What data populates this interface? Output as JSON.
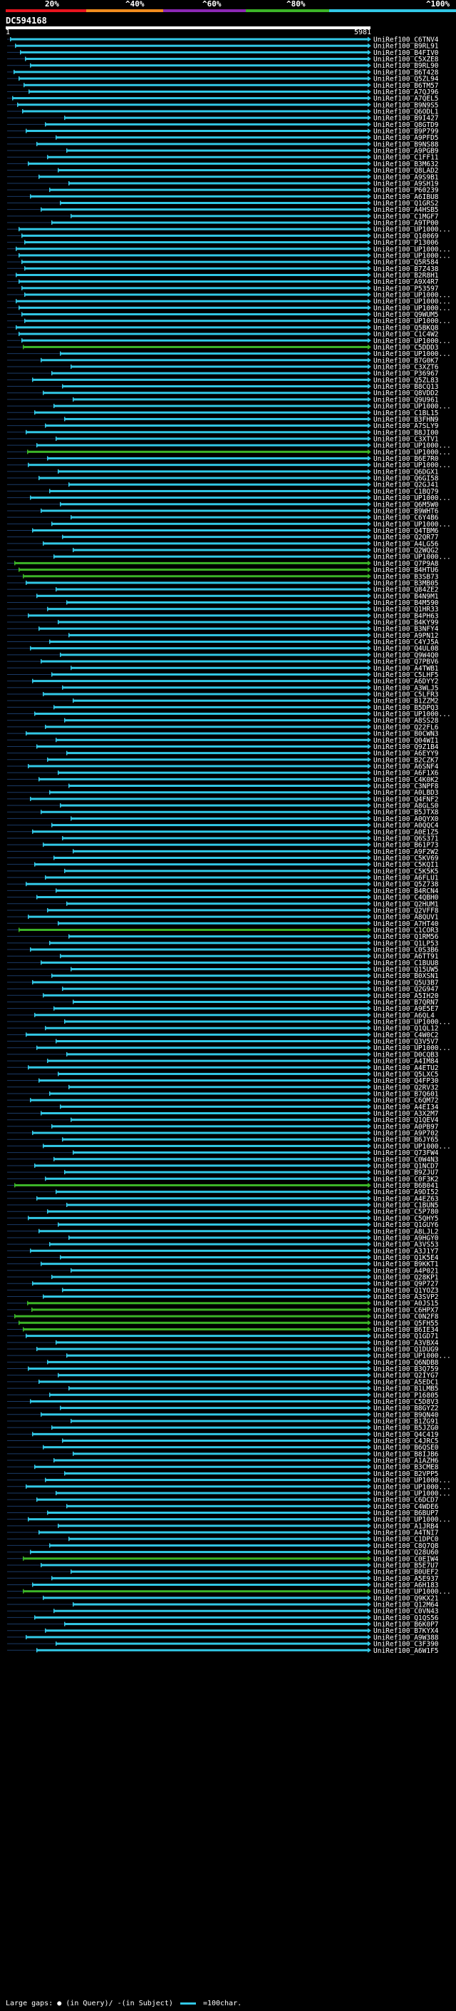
{
  "legend": {
    "labels": [
      "20%",
      "^40%",
      "^60%",
      "^80%",
      "^100%"
    ],
    "colors": [
      "#e8141e",
      "#f08c1e",
      "#8c28b4",
      "#3cb428",
      "#32c8e6"
    ]
  },
  "query": {
    "name": "DC594168",
    "start": "1",
    "end": "5981"
  },
  "footer": {
    "large_gaps_label": "Large gaps:",
    "in_query": "(in Query)/",
    "in_subject": "-(in Subject)",
    "scale_label": "=100char."
  },
  "colors": {
    "cyan": "#32c8e6",
    "green": "#3cb428",
    "white": "#ffffff"
  },
  "hits": [
    "UniRef100_C6TNV4",
    "UniRef100_B9RL91",
    "UniRef100_B4FIV0",
    "UniRef100_C5XZE8",
    "UniRef100_B9RL90",
    "UniRef100_B6T428",
    "UniRef100_Q5ZL94",
    "UniRef100_B6TM57",
    "UniRef100_A7QJ96",
    "UniRef100_A7QEL5",
    "UniRef100_B9N9S5",
    "UniRef100_Q6ODL1",
    "UniRef100_B9I427",
    "UniRef100_Q8GTD9",
    "UniRef100_B9P799",
    "UniRef100_A9PFD5",
    "UniRef100_B9NS88",
    "UniRef100_A9PGB9",
    "UniRef100_C1FF11",
    "UniRef100_B3M632",
    "UniRef100_Q8LAD2",
    "UniRef100_A9S9B1",
    "UniRef100_A9SH19",
    "UniRef100_P60239",
    "UniRef100_A6IBU8",
    "UniRef100_Q1GRS2",
    "UniRef100_A4HSB5",
    "UniRef100_C1MGF7",
    "UniRef100_A9TP00",
    "UniRef100_UP1000...",
    "UniRef100_Q10069",
    "UniRef100_P13006",
    "UniRef100_UP1000...",
    "UniRef100_UP1000...",
    "UniRef100_Q5R584",
    "UniRef100_B7Z438",
    "UniRef100_B2R8H1",
    "UniRef100_A9X4R7",
    "UniRef100_P53597",
    "UniRef100_UP1000...",
    "UniRef100_UP1000...",
    "UniRef100_UP1000...",
    "UniRef100_Q9WUM5",
    "UniRef100_UP1000...",
    "UniRef100_Q5BKQ8",
    "UniRef100_C1C4W2",
    "UniRef100_UP1000...",
    "UniRef100_C5DDD3",
    "UniRef100_UP1000...",
    "UniRef100_B7G0K7",
    "UniRef100_C3XZT6",
    "UniRef100_P36967",
    "UniRef100_Q5ZL83",
    "UniRef100_B8CQ13",
    "UniRef100_Q8VDD2",
    "UniRef100_Q9U961",
    "UniRef100_UP1000...",
    "UniRef100_C1BL15",
    "UniRef100_B3FHN9",
    "UniRef100_A7SLY9",
    "UniRef100_B8JI00",
    "UniRef100_C3XTV1",
    "UniRef100_UP1000...",
    "UniRef100_UP1000...",
    "UniRef100_B6E7R0",
    "UniRef100_UP1000...",
    "UniRef100_Q6DGX1",
    "UniRef100_Q6GI58",
    "UniRef100_Q2GJ41",
    "UniRef100_C1BQ79",
    "UniRef100_UP1000...",
    "UniRef100_Q6M5W0",
    "UniRef100_B9WHT6",
    "UniRef100_C6Y4B6",
    "UniRef100_UP1000...",
    "UniRef100_Q4TBM6",
    "UniRef100_Q2QR77",
    "UniRef100_A4LG56",
    "UniRef100_Q2WQG2",
    "UniRef100_UP1000...",
    "UniRef100_Q7P9A8",
    "UniRef100_B4HTU6",
    "UniRef100_B3SB73",
    "UniRef100_B3MB05",
    "UniRef100_Q84ZE2",
    "UniRef100_B4N9M1",
    "UniRef100_B4M590",
    "UniRef100_Q1HR33",
    "UniRef100_B4PH63",
    "UniRef100_B4KY99",
    "UniRef100_B3NFY4",
    "UniRef100_A9PN12",
    "UniRef100_C4YJ5A",
    "UniRef100_Q4UL08",
    "UniRef100_Q9W4Q0",
    "UniRef100_Q7PBV6",
    "UniRef100_A4TWB1",
    "UniRef100_C5LHF5",
    "UniRef100_A6DYY2",
    "UniRef100_A3WLJ5",
    "UniRef100_C5LFR3",
    "UniRef100_B1ZZM2",
    "UniRef100_B5DPQ3",
    "UniRef100_UP1000...",
    "UniRef100_A8SS28",
    "UniRef100_Q22FL6",
    "UniRef100_B0CWN3",
    "UniRef100_Q04WI1",
    "UniRef100_Q9Z1B4",
    "UniRef100_A6EYY9",
    "UniRef100_B2CZK7",
    "UniRef100_A6SNF4",
    "UniRef100_A6F1X6",
    "UniRef100_C4K0K2",
    "UniRef100_C3NPF8",
    "UniRef100_A0LBD3",
    "UniRef100_Q4FNF2",
    "UniRef100_A8GLS0",
    "UniRef100_B5JTX8",
    "UniRef100_A0QYX0",
    "UniRef100_A0QQC4",
    "UniRef100_A0E1Z5",
    "UniRef100_Q6S371",
    "UniRef100_B61P73",
    "UniRef100_A9F2W2",
    "UniRef100_C5KV69",
    "UniRef100_C5KQI1",
    "UniRef100_C5K5K5",
    "UniRef100_A6FLU1",
    "UniRef100_Q5Z738",
    "UniRef100_B4RCN4",
    "UniRef100_C4QBH0",
    "UniRef100_Q2HUM1",
    "UniRef100_Q2VFF8",
    "UniRef100_A8QUV1",
    "UniRef100_A7HT40",
    "UniRef100_C1COR3",
    "UniRef100_Q1RM56",
    "UniRef100_Q1LP53",
    "UniRef100_C0S3B6",
    "UniRef100_A6TT91",
    "UniRef100_C1BUU8",
    "UniRef100_Q15UW5",
    "UniRef100_B0XSN1",
    "UniRef100_Q5U3B7",
    "UniRef100_Q2G947",
    "UniRef100_A5IH20",
    "UniRef100_B7QRN7",
    "UniRef100_A9E5E7",
    "UniRef100_A6QL4",
    "UniRef100_UP1000...",
    "UniRef100_Q1QL12",
    "UniRef100_C4W0C2",
    "UniRef100_Q3V5V7",
    "UniRef100_UP1000...",
    "UniRef100_D0CQB3",
    "UniRef100_A4IM84",
    "UniRef100_A4ETU2",
    "UniRef100_Q5LXC5",
    "UniRef100_Q4FP30",
    "UniRef100_Q2RV32",
    "UniRef100_B7Q601",
    "UniRef100_C6QM72",
    "UniRef100_A4EI34",
    "UniRef100_A3X2M7",
    "UniRef100_Q1QEV4",
    "UniRef100_A0PB97",
    "UniRef100_A9P702",
    "UniRef100_B6JY65",
    "UniRef100_UP1000...",
    "UniRef100_Q73FW4",
    "UniRef100_C0W4N3",
    "UniRef100_Q1NCD7",
    "UniRef100_B9ZJU7",
    "UniRef100_C0F3K2",
    "UniRef100_B6B041",
    "UniRef100_A9DI52",
    "UniRef100_A4EZ63",
    "UniRef100_C1BUN5",
    "UniRef100_C5P780",
    "UniRef100_C5QHY5",
    "UniRef100_Q1GUY6",
    "UniRef100_A8LJL2",
    "UniRef100_A9HGY0",
    "UniRef100_A3VS53",
    "UniRef100_A3J1Y7",
    "UniRef100_Q1K5E4",
    "UniRef100_B9KKT1",
    "UniRef100_A4P021",
    "UniRef100_Q28KP1",
    "UniRef100_Q9P727",
    "UniRef100_Q1YOZ3",
    "UniRef100_A3SVP2",
    "UniRef100_A0JS15",
    "UniRef100_C6HPX7",
    "UniRef100_C0N2F8",
    "UniRef100_Q5FH55",
    "UniRef100_B6IE34",
    "UniRef100_Q1GD71",
    "UniRef100_A3VBX4",
    "UniRef100_Q1DUG9",
    "UniRef100_UP1000...",
    "UniRef100_Q6NDB8",
    "UniRef100_B3Q759",
    "UniRef100_Q2IYG7",
    "UniRef100_A5EDC1",
    "UniRef100_B1LMB5",
    "UniRef100_P16805",
    "UniRef100_C5D8V3",
    "UniRef100_B8GYZ2",
    "UniRef100_B9QN40",
    "UniRef100_B1ZG91",
    "UniRef100_B5JZG0",
    "UniRef100_Q4C419",
    "UniRef100_C4JRC5",
    "UniRef100_B6QSE0",
    "UniRef100_B8IJB6",
    "UniRef100_A1AZH6",
    "UniRef100_B3CME8",
    "UniRef100_B2VPP5",
    "UniRef100_UP1000...",
    "UniRef100_UP1000...",
    "UniRef100_UP1000...",
    "UniRef100_C6DCD7",
    "UniRef100_C4WDE6",
    "UniRef100_B6BUP7",
    "UniRef100_UP1000...",
    "UniRef100_A1JRB4",
    "UniRef100_A4TNI7",
    "UniRef100_C1DPC0",
    "UniRef100_C8Q7Q8",
    "UniRef100_Q28U60",
    "UniRef100_C0EIW4",
    "UniRef100_B5E7U7",
    "UniRef100_B0UEF2",
    "UniRef100_A5E937",
    "UniRef100_A6H183",
    "UniRef100_UP1000...",
    "UniRef100_Q9KX21",
    "UniRef100_Q12M64",
    "UniRef100_C0VN43",
    "UniRef100_Q1QS56",
    "UniRef100_B6K0P7",
    "UniRef100_B7KYX4",
    "UniRef100_A9W388",
    "UniRef100_C3F390",
    "UniRef100_A6W1F5"
  ]
}
